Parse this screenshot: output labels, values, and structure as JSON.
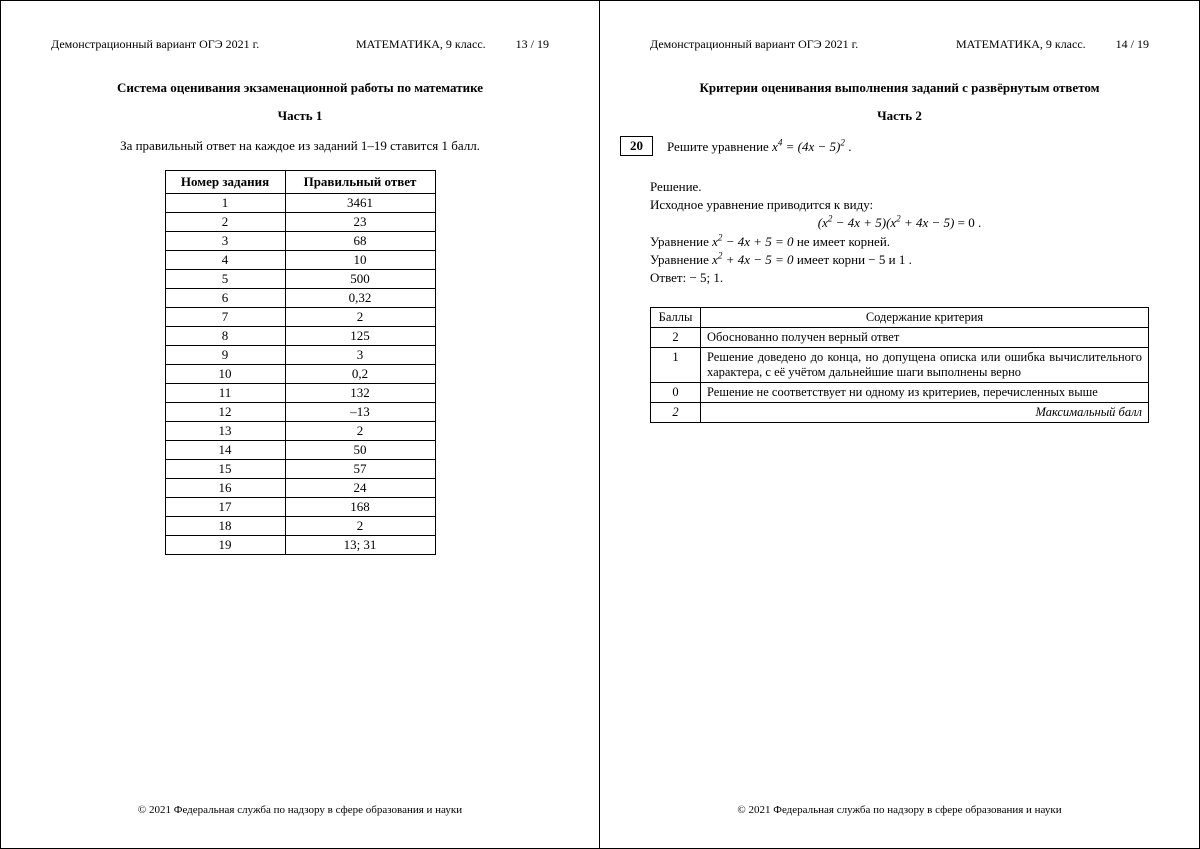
{
  "left": {
    "header": {
      "demo": "Демонстрационный вариант ОГЭ 2021 г.",
      "subject": "МАТЕМАТИКА, 9 класс.",
      "page": "13 / 19"
    },
    "title": "Система оценивания экзаменационной работы по математике",
    "part": "Часть 1",
    "intro": "За правильный ответ на каждое из заданий 1–19 ставится 1 балл.",
    "table": {
      "col1": "Номер задания",
      "col2": "Правильный ответ",
      "rows": [
        {
          "n": "1",
          "a": "3461"
        },
        {
          "n": "2",
          "a": "23"
        },
        {
          "n": "3",
          "a": "68"
        },
        {
          "n": "4",
          "a": "10"
        },
        {
          "n": "5",
          "a": "500"
        },
        {
          "n": "6",
          "a": "0,32"
        },
        {
          "n": "7",
          "a": "2"
        },
        {
          "n": "8",
          "a": "125"
        },
        {
          "n": "9",
          "a": "3"
        },
        {
          "n": "10",
          "a": "0,2"
        },
        {
          "n": "11",
          "a": "132"
        },
        {
          "n": "12",
          "a": "–13"
        },
        {
          "n": "13",
          "a": "2"
        },
        {
          "n": "14",
          "a": "50"
        },
        {
          "n": "15",
          "a": "57"
        },
        {
          "n": "16",
          "a": "24"
        },
        {
          "n": "17",
          "a": "168"
        },
        {
          "n": "18",
          "a": "2"
        },
        {
          "n": "19",
          "a": "13; 31"
        }
      ]
    },
    "footer": "© 2021 Федеральная служба по надзору в сфере образования и науки"
  },
  "right": {
    "header": {
      "demo": "Демонстрационный вариант ОГЭ 2021 г.",
      "subject": "МАТЕМАТИКА, 9 класс.",
      "page": "14 / 19"
    },
    "title": "Критерии оценивания выполнения заданий с развёрнутым ответом",
    "part": "Часть 2",
    "task": {
      "num": "20",
      "prompt_prefix": "Решите уравнение ",
      "prompt_eq": "x⁴ = (4x − 5)²",
      "prompt_suffix": " ."
    },
    "solution": {
      "label": "Решение.",
      "line1": "Исходное уравнение приводится к виду:",
      "eq1": "(x² − 4x + 5)(x² + 4x − 5) = 0 .",
      "line2_prefix": "Уравнение ",
      "line2_eq": "x² − 4x + 5 = 0",
      "line2_suffix": " не имеет корней.",
      "line3_prefix": "Уравнение ",
      "line3_eq": "x² + 4x − 5 = 0",
      "line3_suffix": " имеет корни − 5 и 1 .",
      "answer": "Ответ: − 5; 1."
    },
    "criteria": {
      "col1": "Баллы",
      "col2": "Содержание критерия",
      "rows": [
        {
          "score": "2",
          "desc": "Обоснованно получен верный ответ"
        },
        {
          "score": "1",
          "desc": "Решение доведено до конца, но допущена описка или ошибка вычислительного характера, с её учётом дальнейшие шаги выполнены верно"
        },
        {
          "score": "0",
          "desc": "Решение не соответствует ни одному из критериев, перечисленных выше"
        }
      ],
      "max": {
        "score": "2",
        "desc": "Максимальный балл"
      }
    },
    "footer": "© 2021 Федеральная служба по надзору в сфере образования и науки"
  }
}
